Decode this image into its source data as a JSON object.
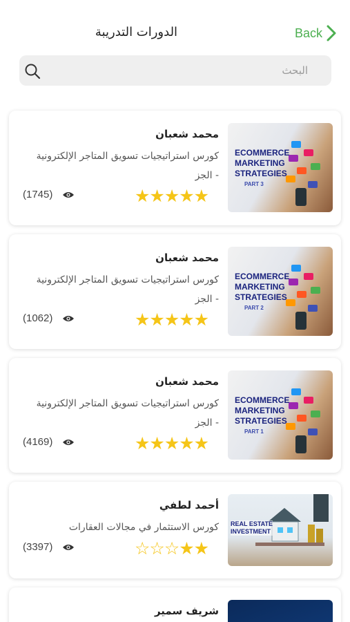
{
  "header": {
    "back_label": "Back",
    "title": "الدورات التدريبة",
    "accent_color": "#4caf50"
  },
  "search": {
    "placeholder": "البحث",
    "icon": "search-icon"
  },
  "courses": [
    {
      "author": "محمد شعبان",
      "title": "كورس استراتيجيات تسويق المتاجر الإلكترونية - الجز",
      "rating": 5,
      "stars": "★★★★★",
      "views": "(1745)",
      "thumb_lines": [
        "ECOMMERCE",
        "MARKETING",
        "STRATEGIES"
      ],
      "thumb_part": "PART 3"
    },
    {
      "author": "محمد شعبان",
      "title": "كورس استراتيجيات تسويق المتاجر الإلكترونية - الجز",
      "rating": 5,
      "stars": "★★★★★",
      "views": "(1062)",
      "thumb_lines": [
        "ECOMMERCE",
        "MARKETING",
        "STRATEGIES"
      ],
      "thumb_part": "PART 2"
    },
    {
      "author": "محمد شعبان",
      "title": "كورس استراتيجيات تسويق المتاجر الإلكترونية - الجز",
      "rating": 5,
      "stars": "★★★★★",
      "views": "(4169)",
      "thumb_lines": [
        "ECOMMERCE",
        "MARKETING",
        "STRATEGIES"
      ],
      "thumb_part": "PART 1"
    },
    {
      "author": "أحمد لطفي",
      "title": "كورس الاستثمار في مجالات العقارات",
      "rating": 2,
      "stars": "☆☆☆★★",
      "views": "(3397)",
      "thumb_lines": [
        "REAL ESTATE",
        "INVESTMENT"
      ]
    },
    {
      "author": "شريف سمير"
    }
  ]
}
